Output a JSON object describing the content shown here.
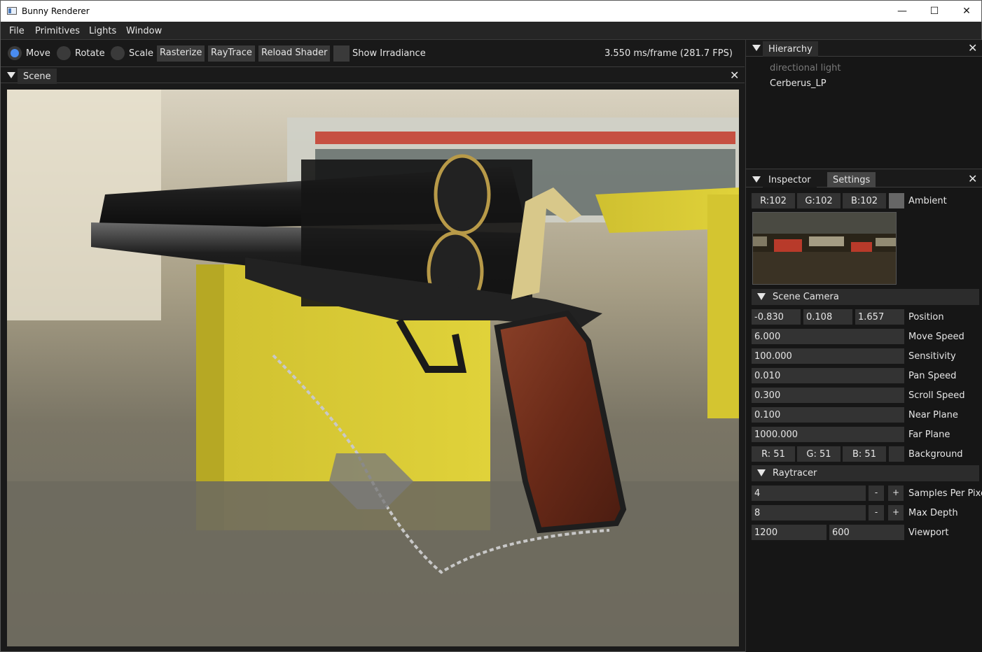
{
  "window": {
    "title": "Bunny Renderer",
    "minimize": "—",
    "maximize": "☐",
    "close": "✕"
  },
  "menu": [
    "File",
    "Primitives",
    "Lights",
    "Window"
  ],
  "toolbar": {
    "move": "Move",
    "rotate": "Rotate",
    "scale": "Scale",
    "rasterize": "Rasterize",
    "raytrace": "RayTrace",
    "reload": "Reload Shader",
    "show_irradiance": "Show Irradiance",
    "fps": "3.550 ms/frame (281.7 FPS)"
  },
  "scene": {
    "tab": "Scene",
    "close": "✕"
  },
  "hierarchy": {
    "tab": "Hierarchy",
    "close": "✕",
    "items": [
      "directional light",
      "Cerberus_LP"
    ]
  },
  "inspector": {
    "tabs": [
      "Inspector",
      "Settings"
    ],
    "close": "✕",
    "ambient": {
      "r": "R:102",
      "g": "G:102",
      "b": "B:102",
      "label": "Ambient",
      "color": "#666666"
    },
    "scene_camera": {
      "title": "Scene Camera",
      "position": {
        "x": "-0.830",
        "y": "0.108",
        "z": "1.657",
        "label": "Position"
      },
      "move_speed": {
        "value": "6.000",
        "label": "Move Speed"
      },
      "sensitivity": {
        "value": "100.000",
        "label": "Sensitivity"
      },
      "pan_speed": {
        "value": "0.010",
        "label": "Pan Speed"
      },
      "scroll_speed": {
        "value": "0.300",
        "label": "Scroll Speed"
      },
      "near_plane": {
        "value": "0.100",
        "label": "Near Plane"
      },
      "far_plane": {
        "value": "1000.000",
        "label": "Far Plane"
      },
      "background": {
        "r": "R: 51",
        "g": "G: 51",
        "b": "B: 51",
        "label": "Background",
        "color": "#333333"
      }
    },
    "raytracer": {
      "title": "Raytracer",
      "samples": {
        "value": "4",
        "minus": "-",
        "plus": "+",
        "label": "Samples Per Pixe"
      },
      "max_depth": {
        "value": "8",
        "minus": "-",
        "plus": "+",
        "label": "Max Depth"
      },
      "viewport": {
        "w": "1200",
        "h": "600",
        "label": "Viewport"
      }
    }
  },
  "colors": {
    "accent": "#4a8cf0",
    "panel": "#333333",
    "frame_yellow": "#d8c71e"
  }
}
